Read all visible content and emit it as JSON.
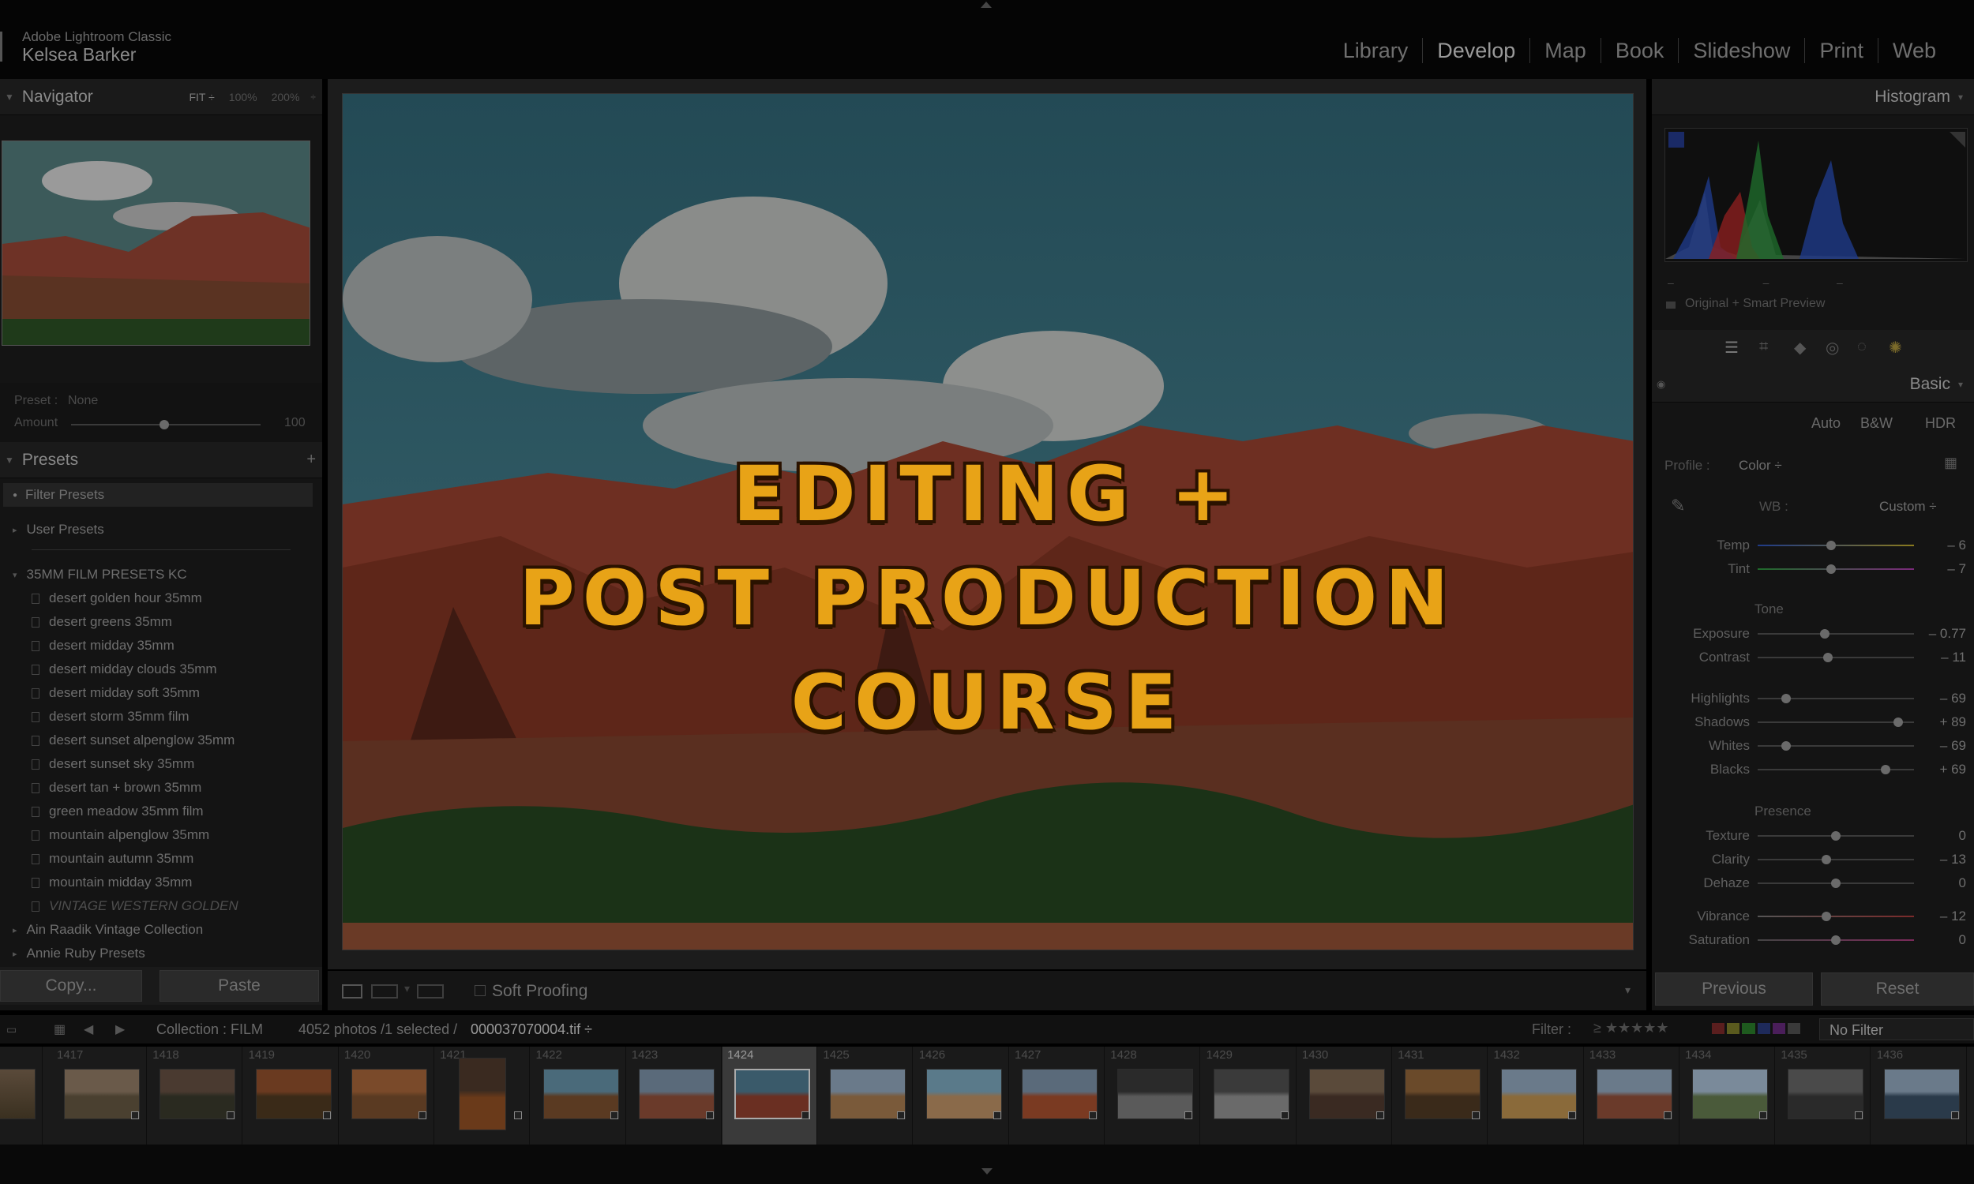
{
  "app": {
    "product": "Adobe Lightroom Classic",
    "user": "Kelsea Barker"
  },
  "modules": [
    "Library",
    "Develop",
    "Map",
    "Book",
    "Slideshow",
    "Print",
    "Web"
  ],
  "active_module": "Develop",
  "navigator": {
    "title": "Navigator",
    "zoom_fit": "FIT ÷",
    "zoom_100": "100%",
    "zoom_200": "200%"
  },
  "preset_amount": {
    "preset_label": "Preset :",
    "preset_value": "None",
    "amount_label": "Amount",
    "amount_value": "100"
  },
  "presets": {
    "title": "Presets",
    "filter": "Filter Presets",
    "user": "User Presets",
    "folder": "35MM FILM PRESETS KC",
    "items": [
      "desert golden hour 35mm",
      "desert greens 35mm",
      "desert midday 35mm",
      "desert midday clouds 35mm",
      "desert midday soft 35mm",
      "desert storm 35mm film",
      "desert sunset alpenglow 35mm",
      "desert sunset sky 35mm",
      "desert tan + brown 35mm",
      "green meadow 35mm film",
      "mountain alpenglow 35mm",
      "mountain autumn 35mm",
      "mountain midday 35mm",
      "VINTAGE WESTERN GOLDEN"
    ],
    "collections": [
      "Ain Raadik Vintage Collection",
      "Annie Ruby Presets"
    ]
  },
  "left_buttons": {
    "copy": "Copy...",
    "paste": "Paste"
  },
  "overlay": {
    "line1": "EDITING +",
    "line2": "POST PRODUCTION",
    "line3": "COURSE"
  },
  "toolbar": {
    "soft_proofing": "Soft Proofing"
  },
  "histogram": {
    "title": "Histogram",
    "preview_label": "Original + Smart Preview"
  },
  "basic": {
    "title": "Basic",
    "auto": "Auto",
    "bw": "B&W",
    "hdr": "HDR",
    "profile_label": "Profile :",
    "profile_value": "Color ÷",
    "wb_label": "WB :",
    "wb_value": "Custom ÷",
    "tone_label": "Tone",
    "presence_label": "Presence",
    "sliders": [
      {
        "label": "Temp",
        "value": "– 6",
        "pos": 0.47
      },
      {
        "label": "Tint",
        "value": "– 7",
        "pos": 0.47
      },
      {
        "label": "Exposure",
        "value": "– 0.77",
        "pos": 0.43
      },
      {
        "label": "Contrast",
        "value": "– 11",
        "pos": 0.45
      },
      {
        "label": "Highlights",
        "value": "– 69",
        "pos": 0.18
      },
      {
        "label": "Shadows",
        "value": "+ 89",
        "pos": 0.9
      },
      {
        "label": "Whites",
        "value": "– 69",
        "pos": 0.18
      },
      {
        "label": "Blacks",
        "value": "+ 69",
        "pos": 0.82
      },
      {
        "label": "Texture",
        "value": "0",
        "pos": 0.5
      },
      {
        "label": "Clarity",
        "value": "– 13",
        "pos": 0.44
      },
      {
        "label": "Dehaze",
        "value": "0",
        "pos": 0.5
      },
      {
        "label": "Vibrance",
        "value": "– 12",
        "pos": 0.44
      },
      {
        "label": "Saturation",
        "value": "0",
        "pos": 0.5
      }
    ]
  },
  "right_buttons": {
    "previous": "Previous",
    "reset": "Reset"
  },
  "filmstrip_bar": {
    "collection": "Collection : FILM",
    "count": "4052 photos /1 selected /",
    "filename": "000037070004.tif ÷",
    "filter_label": "Filter :",
    "no_filter": "No Filter"
  },
  "filmstrip": {
    "numbers": [
      "1417",
      "1418",
      "1419",
      "1420",
      "1421",
      "1422",
      "1423",
      "1424",
      "1425",
      "1426",
      "1427",
      "1428",
      "1429",
      "1430",
      "1431",
      "1432",
      "1433",
      "1434",
      "1435",
      "1436"
    ],
    "selected": "1424"
  },
  "colors": {
    "accent": "#e8a317",
    "background": "#141414"
  }
}
